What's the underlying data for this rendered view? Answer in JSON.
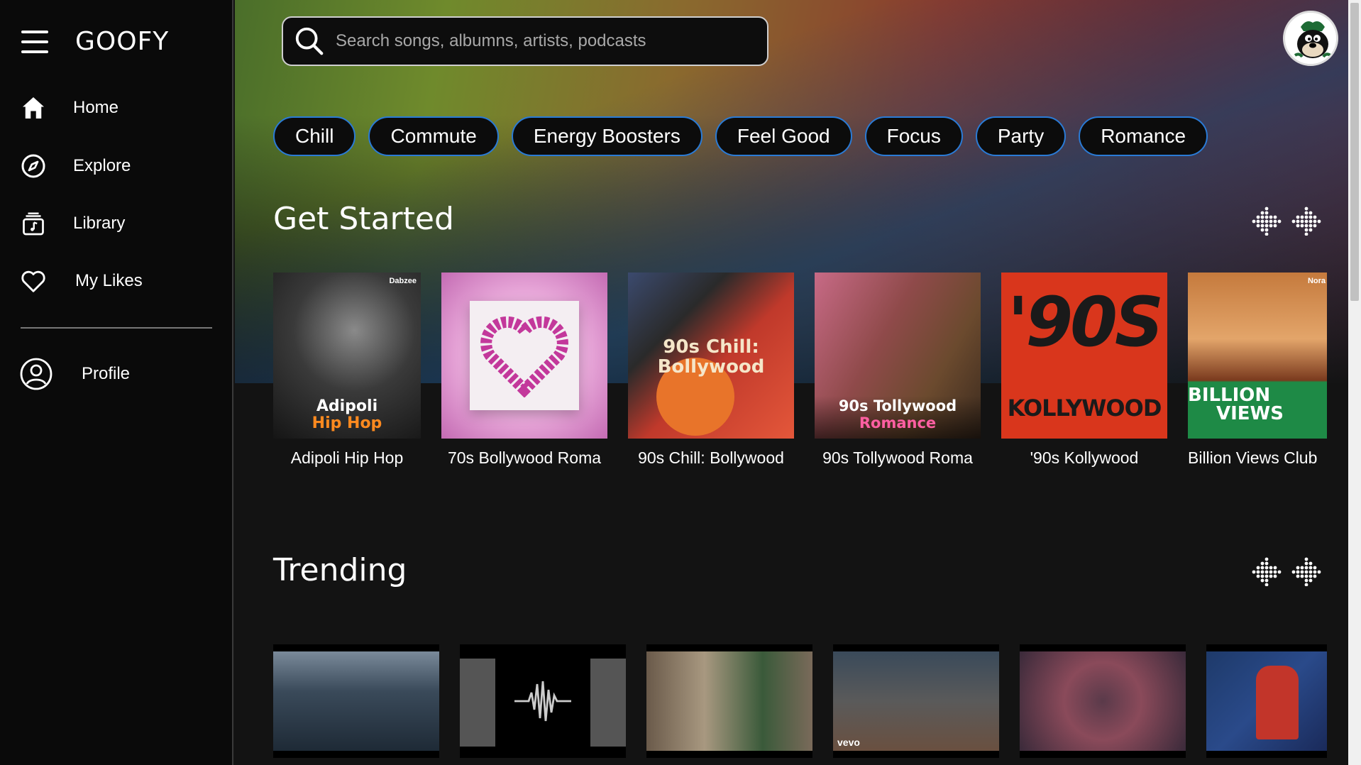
{
  "app": {
    "brand": "GOOFY"
  },
  "sidebar": {
    "items": [
      {
        "label": "Home",
        "icon": "home-icon"
      },
      {
        "label": "Explore",
        "icon": "compass-icon"
      },
      {
        "label": "Library",
        "icon": "library-icon"
      },
      {
        "label": "My Likes",
        "icon": "heart-icon"
      }
    ],
    "profile": {
      "label": "Profile",
      "icon": "profile-icon"
    }
  },
  "search": {
    "placeholder": "Search songs, albumns, artists, podcasts"
  },
  "chips": [
    "Chill",
    "Commute",
    "Energy Boosters",
    "Feel Good",
    "Focus",
    "Party",
    "Romance"
  ],
  "sections": {
    "get_started": {
      "title": "Get Started",
      "cards": [
        {
          "title": "Adipoli Hip Hop",
          "art_line1": "Adipoli",
          "art_line2": "Hip Hop",
          "badge": "Dabzee"
        },
        {
          "title": "70s Bollywood Roma"
        },
        {
          "title": "90s Chill: Bollywood",
          "art_line1": "90s Chill:",
          "art_line2": "Bollywood"
        },
        {
          "title": "90s Tollywood Roma",
          "art_line1": "90s Tollywood",
          "art_line2": "Romance"
        },
        {
          "title": "'90s Kollywood",
          "art_line1": "'90S",
          "art_line2": "KOLLYWOOD"
        },
        {
          "title": "Billion Views Club",
          "art_line1": "BILLION",
          "art_line2": "VIEWS",
          "badge": "Nora"
        }
      ]
    },
    "trending": {
      "title": "Trending",
      "items": [
        {
          "label": ""
        },
        {
          "label": ""
        },
        {
          "label": ""
        },
        {
          "label": "vevo"
        },
        {
          "label": ""
        },
        {
          "label": ""
        }
      ]
    }
  },
  "colors": {
    "accent": "#2a7bd6",
    "sidebar_bg": "#0a0a0a",
    "main_bg": "#131313"
  }
}
